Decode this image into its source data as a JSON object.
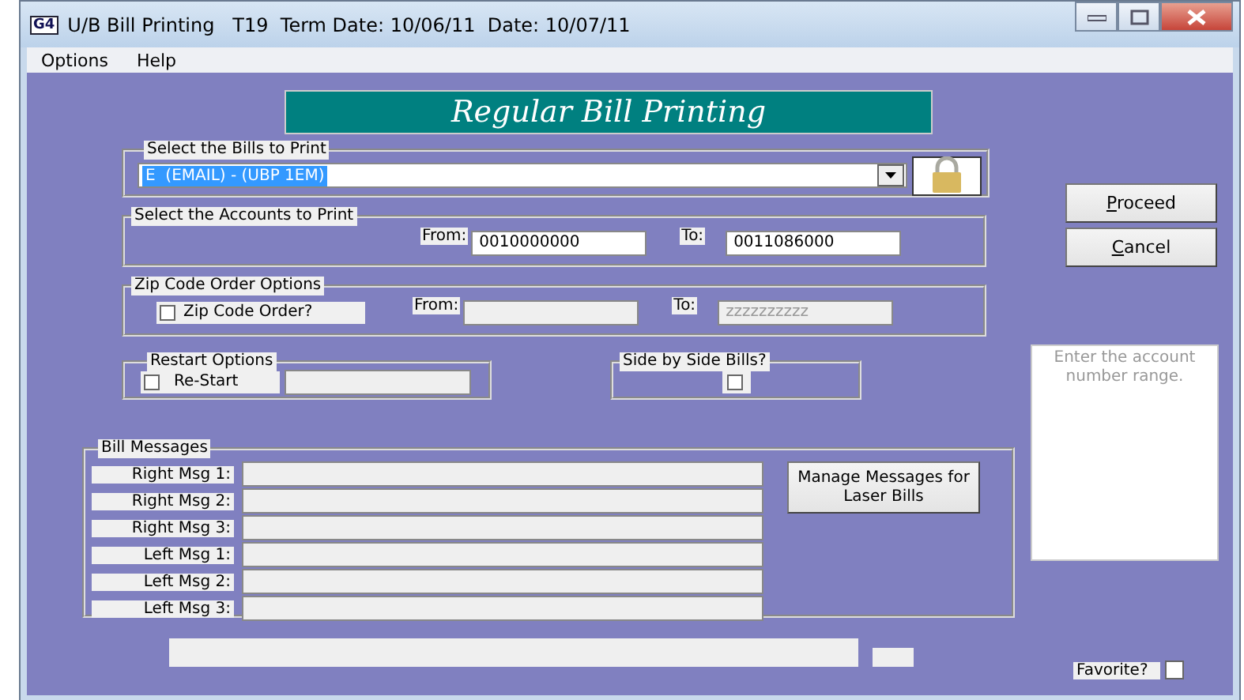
{
  "window": {
    "icon_text": "G4",
    "title": "U/B Bill Printing   T19  Term Date: 10/06/11  Date: 10/07/11"
  },
  "menu": [
    {
      "label": "Options"
    },
    {
      "label": "Help"
    }
  ],
  "banner": "Regular Bill Printing",
  "bills_group": {
    "legend": "Select the Bills to Print",
    "value": "E  (EMAIL) - (UBP 1EM)"
  },
  "accounts_group": {
    "legend": "Select the Accounts to Print",
    "from_label": "From:",
    "from_value": "0010000000",
    "to_label": "To:",
    "to_value": "0011086000"
  },
  "zip_group": {
    "legend": "Zip Code Order Options",
    "checkbox": {
      "label": "Zip Code Order?",
      "checked": false
    },
    "from_label": "From:",
    "from_disabled": true,
    "to_label": "To:",
    "to_value": "zzzzzzzzzz",
    "to_disabled": true
  },
  "restart_group": {
    "legend": "Restart Options",
    "checkbox": {
      "label": "Re-Start",
      "checked": false
    },
    "field_disabled": true
  },
  "side_by_side_group": {
    "legend": "Side by Side Bills?",
    "checked": false
  },
  "messages_group": {
    "legend": "Bill Messages",
    "rows": [
      {
        "label": "Right Msg 1:"
      },
      {
        "label": "Right Msg 2:"
      },
      {
        "label": "Right Msg 3:"
      },
      {
        "label": "Left Msg 1:"
      },
      {
        "label": "Left Msg 2:"
      },
      {
        "label": "Left Msg 3:"
      }
    ],
    "manage_button": "Manage Messages for Laser Bills"
  },
  "buttons": [
    {
      "label": "Proceed"
    },
    {
      "label": "Cancel"
    }
  ],
  "hint": "Enter the account number range.",
  "favorite": {
    "label": "Favorite?",
    "checked": false
  }
}
